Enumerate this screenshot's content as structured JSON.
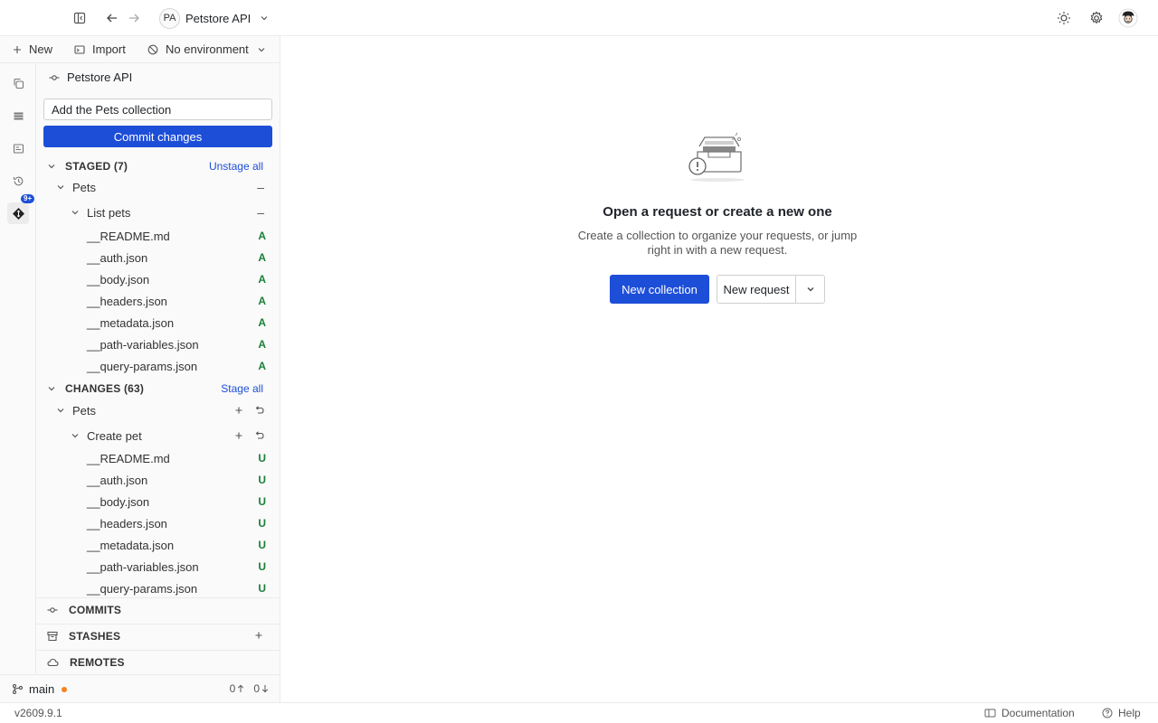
{
  "topbar": {
    "workspace_initials": "PA",
    "workspace_name": "Petstore API"
  },
  "sidebar_toolbar": {
    "new_label": "New",
    "import_label": "Import",
    "environment_label": "No environment"
  },
  "rail": {
    "badge": "9+"
  },
  "git": {
    "repo_name": "Petstore API",
    "commit_message": "Add the Pets collection",
    "commit_button": "Commit changes",
    "staged": {
      "title": "STAGED (7)",
      "action": "Unstage all",
      "folder": "Pets",
      "request": "List pets",
      "files": [
        {
          "name": "__README.md",
          "status": "A"
        },
        {
          "name": "__auth.json",
          "status": "A"
        },
        {
          "name": "__body.json",
          "status": "A"
        },
        {
          "name": "__headers.json",
          "status": "A"
        },
        {
          "name": "__metadata.json",
          "status": "A"
        },
        {
          "name": "__path-variables.json",
          "status": "A"
        },
        {
          "name": "__query-params.json",
          "status": "A"
        }
      ]
    },
    "changes": {
      "title": "CHANGES (63)",
      "action": "Stage all",
      "folder": "Pets",
      "request": "Create pet",
      "files": [
        {
          "name": "__README.md",
          "status": "U"
        },
        {
          "name": "__auth.json",
          "status": "U"
        },
        {
          "name": "__body.json",
          "status": "U"
        },
        {
          "name": "__headers.json",
          "status": "U"
        },
        {
          "name": "__metadata.json",
          "status": "U"
        },
        {
          "name": "__path-variables.json",
          "status": "U"
        },
        {
          "name": "__query-params.json",
          "status": "U"
        }
      ]
    },
    "commits_label": "COMMITS",
    "stashes_label": "STASHES",
    "remotes_label": "REMOTES",
    "branch": "main",
    "ahead": "0",
    "behind": "0"
  },
  "empty_state": {
    "title": "Open a request or create a new one",
    "description": "Create a collection to organize your requests, or jump right in with a new request.",
    "new_collection": "New collection",
    "new_request": "New request"
  },
  "statusbar": {
    "version": "v2609.9.1",
    "documentation": "Documentation",
    "help": "Help"
  },
  "colors": {
    "accent": "#1d4ed8",
    "status_added": "#1a7f37",
    "dirty_dot": "#f5821f"
  }
}
